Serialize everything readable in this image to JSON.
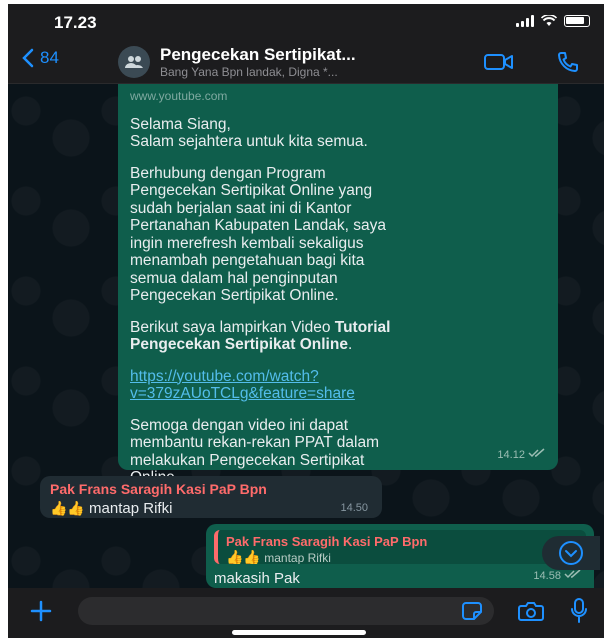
{
  "status": {
    "time": "17.23"
  },
  "header": {
    "back_count": "84",
    "title": "Pengecekan Sertipikat...",
    "subtitle": "Bang Yana Bpn landak, Digna *..."
  },
  "message_out": {
    "url": "www.youtube.com",
    "p1": "Selama Siang,\nSalam sejahtera untuk kita semua.",
    "p2": "Berhubung dengan Program\nPengecekan Sertipikat Online yang\nsudah berjalan saat ini di Kantor\nPertanahan Kabupaten Landak, saya\ningin merefresh kembali sekaligus\nmenambah pengetahuan bagi kita\nsemua dalam hal penginputan\nPengecekan Sertipikat Online.",
    "p3_prefix": "Berikut saya lampirkan Video ",
    "p3_bold": "Tutorial\nPengecekan Sertipikat Online",
    "p3_suffix": ".",
    "link": "https://youtube.com/watch?\nv=379zAUoTCLg&feature=share",
    "p4": "Semoga dengan video ini dapat\nmembantu rekan-rekan PPAT dalam\nmelakukan Pengecekan Sertipikat\nOnline.\nTerimakasih.",
    "time": "14.12"
  },
  "message_in": {
    "sender": "Pak Frans Saragih Kasi PaP Bpn",
    "emoji": "👍👍",
    "text": "mantap Rifki",
    "time": "14.50"
  },
  "reply": {
    "quote_sender": "Pak Frans Saragih Kasi PaP Bpn",
    "quote_emoji": "👍👍",
    "quote_text": "mantap Rifki",
    "text": "makasih Pak",
    "time": "14.58"
  },
  "colors": {
    "accent": "#1e90ff",
    "bubble_out": "#0f5e4c",
    "bubble_in": "#202c33",
    "sender_name": "#ff6b6b",
    "link": "#53bdeb"
  },
  "icons": [
    "chevron-left-icon",
    "group-avatar-icon",
    "video-call-icon",
    "phone-icon",
    "plus-icon",
    "sticker-icon",
    "camera-icon",
    "mic-icon",
    "chevron-down-icon"
  ]
}
